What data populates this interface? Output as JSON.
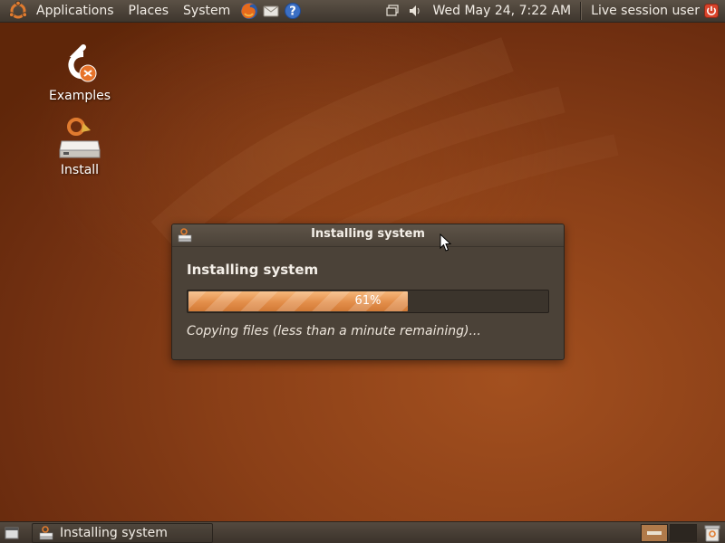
{
  "top_panel": {
    "menus": [
      "Applications",
      "Places",
      "System"
    ],
    "launchers": [
      "firefox-icon",
      "mail-icon",
      "help-icon"
    ],
    "clock": "Wed May 24,  7:22 AM",
    "user": "Live session user"
  },
  "desktop": {
    "icons": [
      {
        "label": "Examples",
        "icon": "examples-icon"
      },
      {
        "label": "Install",
        "icon": "install-icon"
      }
    ]
  },
  "dialog": {
    "title": "Installing system",
    "heading": "Installing system",
    "progress_label": "61%",
    "progress_fraction": 0.61,
    "status": "Copying files (less than a minute remaining)..."
  },
  "bottom_panel": {
    "task_label": "Installing system"
  },
  "colors": {
    "accent": "#e38e4a",
    "panel": "#4b4238"
  }
}
